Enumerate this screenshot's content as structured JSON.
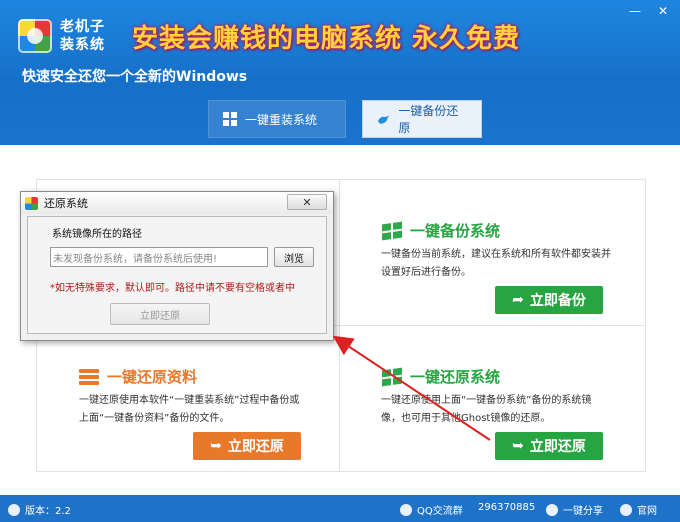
{
  "app": {
    "brand_line1": "老机子",
    "brand_line2": "装系统",
    "slogan": "安装会赚钱的电脑系统 永久免费",
    "subtitle": "快速安全还您一个全新的Windows",
    "window_controls": [
      "minimize",
      "close"
    ]
  },
  "tabs": [
    {
      "label": "一键重装系统",
      "icon": "windows-icon",
      "active": false
    },
    {
      "label": "一键备份还原",
      "icon": "bird-icon",
      "active": true
    }
  ],
  "cards": {
    "backup_system": {
      "title": "一键备份系统",
      "desc": "一键备份当前系统，建议在系统和所有软件都安装并设置好后进行备份。",
      "button": "立即备份"
    },
    "restore_data": {
      "title": "一键还原资料",
      "desc": "一键还原使用本软件“一键重装系统”过程中备份或上面“一键备份资料”备份的文件。",
      "button": "立即还原"
    },
    "restore_system": {
      "title": "一键还原系统",
      "desc": "一键还原使用上面“一键备份系统”备份的系统镜像，也可用于其他Ghost镜像的还原。",
      "button": "立即还原"
    }
  },
  "dialog": {
    "title": "还原系统",
    "close_label": "✕",
    "path_label": "系统镜像所在的路径",
    "path_value": "未发现备份系统，请备份系统后使用!",
    "browse_label": "浏览",
    "note": "*如无特殊要求，默认即可。路径中请不要有空格或者中",
    "restore_label": "立即还原"
  },
  "footer": {
    "version": "版本：2.2",
    "qq_label": "QQ交流群",
    "qq_number": "296370885",
    "share": "一键分享",
    "website": "官网"
  },
  "colors": {
    "header_blue": "#1670c8",
    "slogan_yellow": "#ffd43b",
    "green": "#27a543",
    "orange": "#e8782a",
    "note_red": "#b01818"
  }
}
